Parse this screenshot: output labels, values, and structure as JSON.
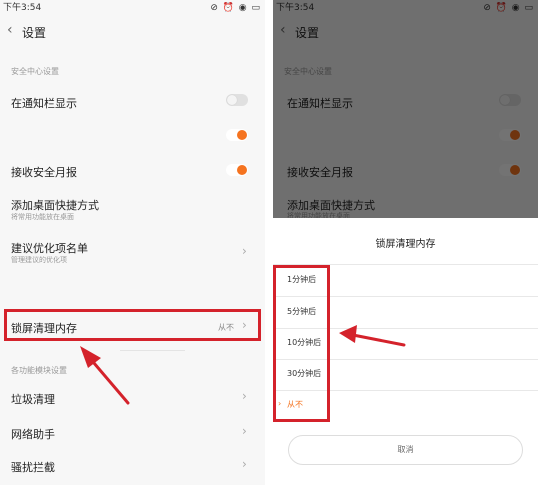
{
  "status": {
    "time": "下午3:54",
    "icons": "⊘ ⏰ ◉ ▭"
  },
  "header": {
    "title": "设置",
    "back_icon": "‹"
  },
  "left": {
    "section1": "安全中心设置",
    "rows": {
      "notif": "在通知栏显示",
      "report": "接收安全月报",
      "shortcut": "添加桌面快捷方式",
      "shortcut_sub": "将常用功能放在桌面",
      "suggest": "建议优化项名单",
      "suggest_sub": "管理建议的优化项",
      "lock": "锁屏清理内存",
      "lock_value": "从不"
    },
    "section2": "各功能模块设置",
    "module_rows": {
      "trash": "垃圾清理",
      "network": "网络助手",
      "block": "骚扰拦截"
    }
  },
  "right": {
    "sheet_title": "锁屏清理内存",
    "options": [
      "1分钟后",
      "5分钟后",
      "10分钟后",
      "30分钟后",
      "从不"
    ],
    "selected_index": 4,
    "check_mark": "›",
    "cancel": "取消"
  },
  "colors": {
    "accent": "#f5731f",
    "annotation_red": "#d4222b"
  }
}
